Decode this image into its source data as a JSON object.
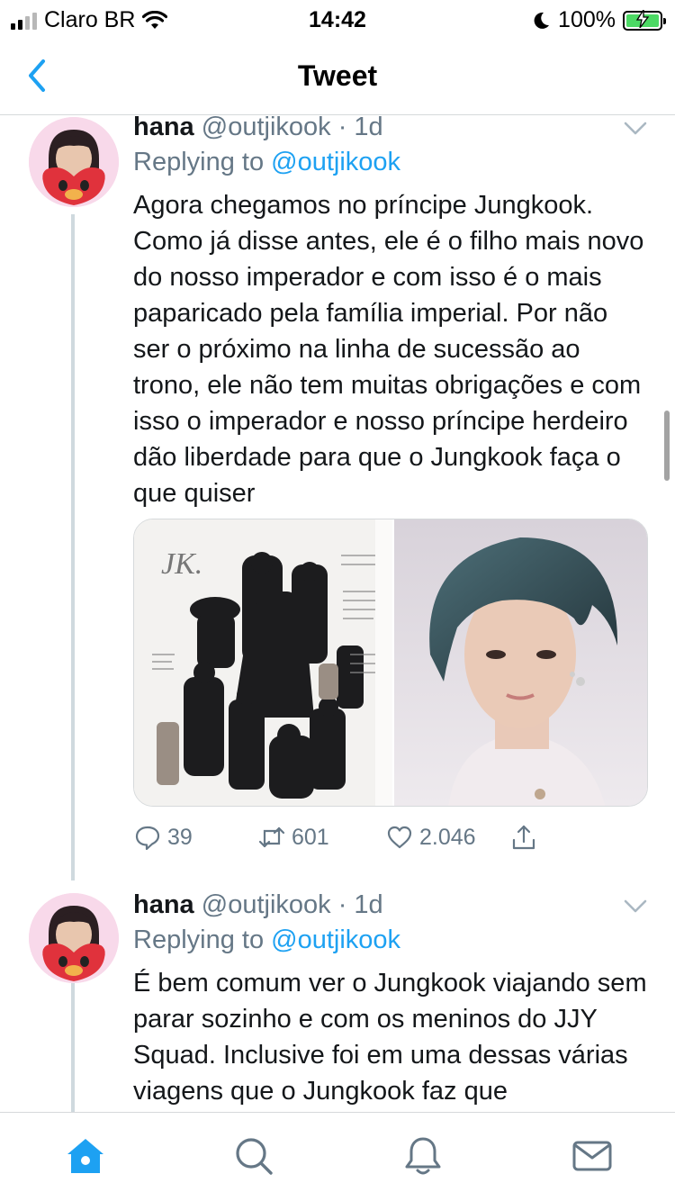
{
  "status_bar": {
    "carrier": "Claro BR",
    "time": "14:42",
    "battery": "100%"
  },
  "nav": {
    "title": "Tweet"
  },
  "tweets": [
    {
      "name": "hana",
      "handle_time": "@outjikook · 1d",
      "replying_prefix": "Replying to ",
      "replying_to": "@outjikook",
      "text": "Agora chegamos no príncipe Jungkook. Como já disse antes, ele é o filho mais novo do nosso imperador e com isso é o mais paparicado pela família imperial. Por não ser o próximo na linha de sucessão ao trono, ele não tem muitas obrigações e com isso o imperador e nosso príncipe herdeiro dão liberdade para que o Jungkook faça o que quiser",
      "replies": "39",
      "retweets": "601",
      "likes": "2.046"
    },
    {
      "name": "hana",
      "handle_time": "@outjikook · 1d",
      "replying_prefix": "Replying to ",
      "replying_to": "@outjikook",
      "text": "É bem comum ver o Jungkook viajando sem parar sozinho e com os meninos do JJY Squad. Inclusive foi em uma dessas várias viagens que o Jungkook faz que"
    }
  ],
  "icons": {
    "back": "chevron-left-icon",
    "caret": "chevron-down-icon",
    "reply": "comment-icon",
    "retweet": "retweet-icon",
    "like": "heart-icon",
    "share": "share-icon",
    "home": "home-icon",
    "search": "search-icon",
    "notifications": "bell-icon",
    "messages": "mail-icon"
  },
  "colors": {
    "accent": "#1da1f2",
    "secondary_text": "#657786",
    "battery": "#4cd964"
  }
}
